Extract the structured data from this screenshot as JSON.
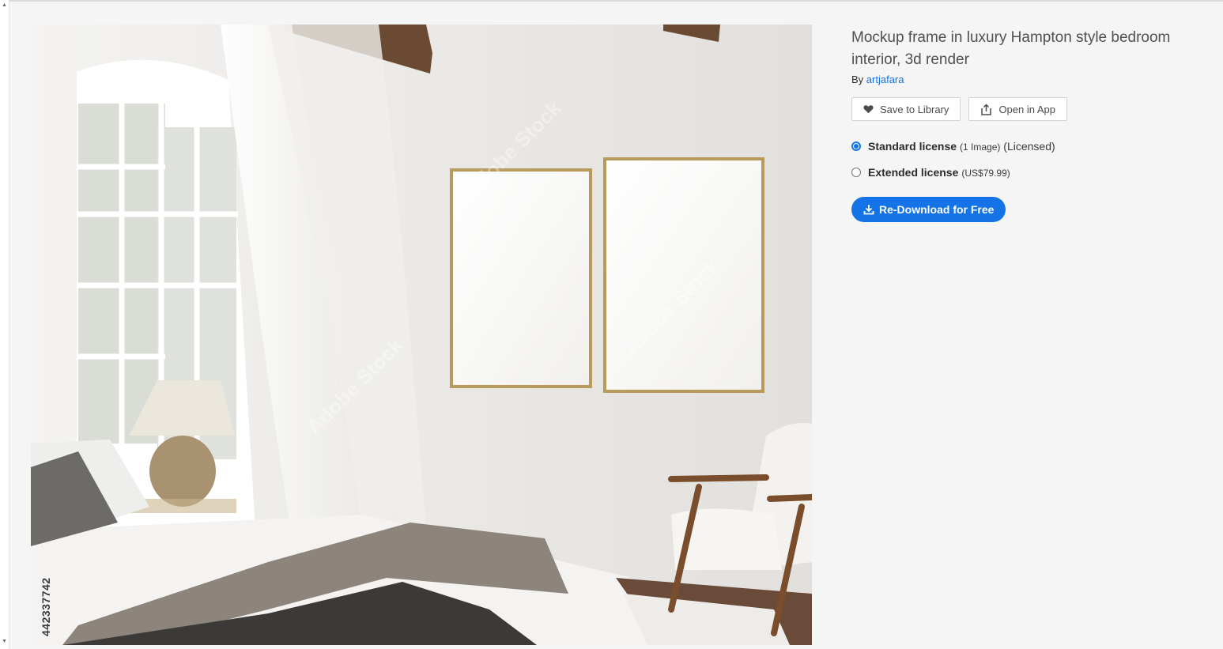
{
  "asset": {
    "title": "Mockup frame in luxury Hampton style bedroom interior, 3d render",
    "by_prefix": "By",
    "author": "artjafara",
    "image_id": "442337742",
    "watermark": "Adobe Stock"
  },
  "actions": {
    "save_label": "Save to Library",
    "open_label": "Open in App"
  },
  "licenses": [
    {
      "name": "Standard license",
      "detail_small": "(1 Image)",
      "detail": "(Licensed)",
      "selected": true
    },
    {
      "name": "Extended license",
      "detail_small": "(US$79.99)",
      "detail": "",
      "selected": false
    }
  ],
  "download": {
    "label": "Re-Download for Free"
  },
  "colors": {
    "accent": "#1473e6",
    "background": "#f5f5f5"
  },
  "icons": [
    "heart-icon",
    "share-icon",
    "download-icon"
  ]
}
